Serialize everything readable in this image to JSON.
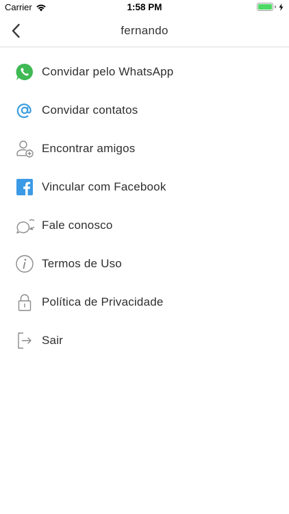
{
  "status_bar": {
    "carrier": "Carrier",
    "time": "1:58 PM",
    "battery_level": 1.0
  },
  "nav": {
    "title": "fernando",
    "back_icon": "chevron-left-icon"
  },
  "menu": {
    "items": [
      {
        "label": "Convidar pelo WhatsApp",
        "icon": "whatsapp-icon",
        "color": "#3fb953"
      },
      {
        "label": "Convidar contatos",
        "icon": "at-sign-icon",
        "color": "#3d9ee0"
      },
      {
        "label": "Encontrar amigos",
        "icon": "add-user-icon",
        "color": "#8a8a8a"
      },
      {
        "label": "Vincular com Facebook",
        "icon": "facebook-icon",
        "color": "#3b9ae6"
      },
      {
        "label": "Fale conosco",
        "icon": "chat-bubbles-icon",
        "color": "#8a8a8a"
      },
      {
        "label": "Termos de Uso",
        "icon": "info-icon",
        "color": "#8a8a8a"
      },
      {
        "label": "Política de Privacidade",
        "icon": "lock-icon",
        "color": "#8a8a8a"
      },
      {
        "label": "Sair",
        "icon": "logout-icon",
        "color": "#8a8a8a"
      }
    ]
  }
}
